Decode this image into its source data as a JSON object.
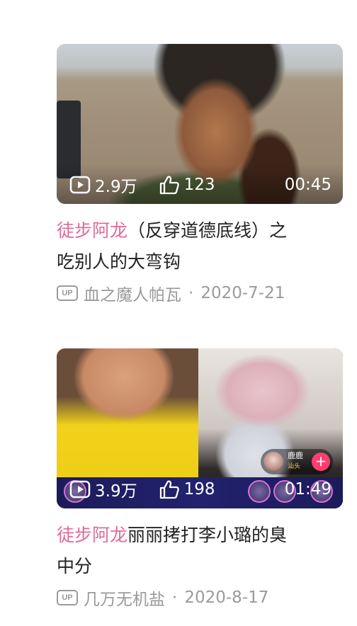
{
  "videos": [
    {
      "views": "2.9万",
      "likes": "123",
      "duration": "00:45",
      "title_highlight": "徒步阿龙",
      "title_rest_line1": "（反穿道德底线）之",
      "title_rest_line2": "吃别人的大弯钩",
      "up_label": "UP",
      "author": "血之魔人帕瓦",
      "separator": "·",
      "date": "2020-7-21"
    },
    {
      "views": "3.9万",
      "likes": "198",
      "duration": "01:49",
      "live_name": "鹿鹿",
      "live_location": "汕头",
      "live_add": "+",
      "title_highlight": "徒步阿龙",
      "title_rest_line1": "丽丽拷打李小璐的臭",
      "title_rest_line2": "中分",
      "up_label": "UP",
      "author": "几万无机盐",
      "separator": "·",
      "date": "2020-8-17"
    }
  ],
  "colors": {
    "highlight": "#e06a9a",
    "title_text": "#222222",
    "meta_text": "#9a9a9a"
  },
  "icons": [
    "play-count-icon",
    "like-thumb-icon",
    "up-badge-icon",
    "follow-plus-icon"
  ]
}
